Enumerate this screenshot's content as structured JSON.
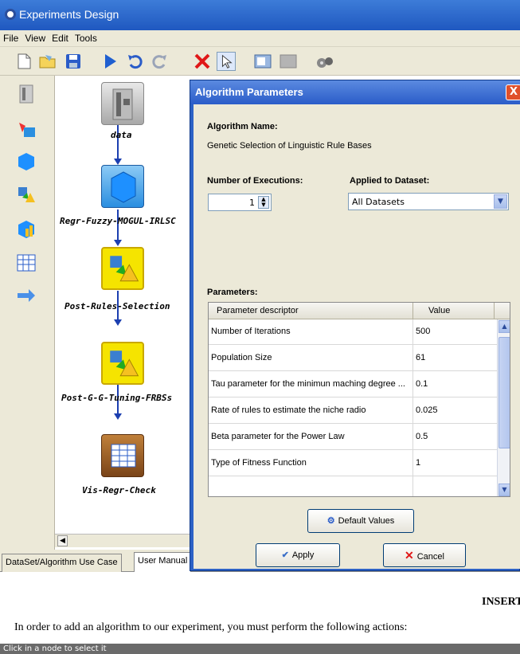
{
  "window": {
    "title": "Experiments Design"
  },
  "menu": [
    "File",
    "View",
    "Edit",
    "Tools"
  ],
  "toolbar_icons": [
    "new-document-icon",
    "open-folder-icon",
    "save-icon",
    "run-icon",
    "undo-icon",
    "redo-icon",
    "delete-icon",
    "select-pointer-icon",
    "snapshot-icon",
    "grid-icon",
    "settings-icon"
  ],
  "sidebar_icons": [
    "dataset-icon",
    "preprocess-icon",
    "method-icon",
    "postprocess-icon",
    "statistics-icon",
    "visualization-icon",
    "connection-arrow-icon"
  ],
  "nodes": [
    {
      "label": "data",
      "kind": "dataset"
    },
    {
      "label": "Regr-Fuzzy-MOGUL-IRLSC",
      "kind": "method"
    },
    {
      "label": "Post-Rules-Selection",
      "kind": "postprocess"
    },
    {
      "label": "Post-G-G-Tuning-FRBSs",
      "kind": "postprocess"
    },
    {
      "label": "Vis-Regr-Check",
      "kind": "visualization"
    }
  ],
  "tabs": [
    "DataSet/Algorithm Use Case",
    "User Manual"
  ],
  "manual": {
    "heading": "INSERT",
    "text": "In order to add an algorithm to our experiment, you must perform the following actions:"
  },
  "status": "Click in a node to select it",
  "dialog": {
    "title": "Algorithm Parameters",
    "close": "X",
    "algorithm_name_label": "Algorithm Name:",
    "algorithm_name": "Genetic Selection of Linguistic Rule Bases",
    "executions_label": "Number of Executions:",
    "executions_value": "1",
    "dataset_label": "Applied to Dataset:",
    "dataset_value": "All Datasets",
    "parameters_label": "Parameters:",
    "columns": [
      "Parameter descriptor",
      "Value"
    ],
    "rows": [
      {
        "name": "Number of Iterations",
        "value": "500"
      },
      {
        "name": "Population Size",
        "value": "61"
      },
      {
        "name": "Tau parameter for the minimun maching degree ...",
        "value": "0.1"
      },
      {
        "name": "Rate of rules to estimate the niche radio",
        "value": "0.025"
      },
      {
        "name": "Beta parameter for the Power Law",
        "value": "0.5"
      },
      {
        "name": "Type of Fitness Function",
        "value": "1"
      }
    ],
    "default_button": "Default Values",
    "apply_button": "Apply",
    "cancel_button": "Cancel"
  },
  "colors": {
    "title_blue": "#2a5cc8",
    "panel": "#ece9d8",
    "node_method": "#3aa0e8",
    "node_post": "#f5e400",
    "node_vis": "#a0602a"
  }
}
